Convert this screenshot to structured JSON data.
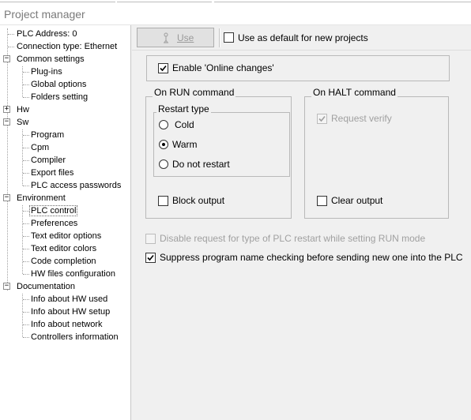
{
  "window": {
    "title": "Project manager"
  },
  "tree": {
    "items": [
      {
        "label": "PLC Address: 0"
      },
      {
        "label": "Connection type: Ethernet"
      },
      {
        "label": "Common settings"
      },
      {
        "label": "Plug-ins"
      },
      {
        "label": "Global options"
      },
      {
        "label": "Folders setting"
      },
      {
        "label": "Hw"
      },
      {
        "label": "Sw"
      },
      {
        "label": "Program"
      },
      {
        "label": "Cpm"
      },
      {
        "label": "Compiler"
      },
      {
        "label": "Export files"
      },
      {
        "label": "PLC access passwords"
      },
      {
        "label": "Environment"
      },
      {
        "label": "PLC control"
      },
      {
        "label": "Preferences"
      },
      {
        "label": "Text editor options"
      },
      {
        "label": "Text editor colors"
      },
      {
        "label": "Code completion"
      },
      {
        "label": "HW files configuration"
      },
      {
        "label": "Documentation"
      },
      {
        "label": "Info about HW used"
      },
      {
        "label": "Info about HW setup"
      },
      {
        "label": "Info about network"
      },
      {
        "label": "Controllers information"
      }
    ]
  },
  "toolbar": {
    "use_label": "Use",
    "default_label": "Use as default for new projects",
    "default_checked": false,
    "use_icon": "person-plug-icon"
  },
  "panel": {
    "enable_online_label": "Enable 'Online changes'",
    "enable_online_checked": true,
    "run": {
      "title": "On RUN command",
      "restart_title": "Restart type",
      "options": [
        "Cold",
        "Warm",
        "Do not restart"
      ],
      "selected": "Warm",
      "block_output_label": "Block output",
      "block_output_checked": false
    },
    "halt": {
      "title": "On HALT command",
      "request_verify_label": "Request verify",
      "request_verify_checked": true,
      "request_verify_enabled": false,
      "clear_output_label": "Clear output",
      "clear_output_checked": false
    },
    "disable_request_label": "Disable request for type of PLC restart while setting RUN mode",
    "disable_request_checked": false,
    "disable_request_enabled": false,
    "suppress_label": "Suppress program name checking before sending new one into the PLC",
    "suppress_checked": true
  },
  "colors": {
    "accent_disabled": "#a0a0a0",
    "tree_bg": "#ffffff",
    "panel_bg": "#f0f0f0"
  }
}
